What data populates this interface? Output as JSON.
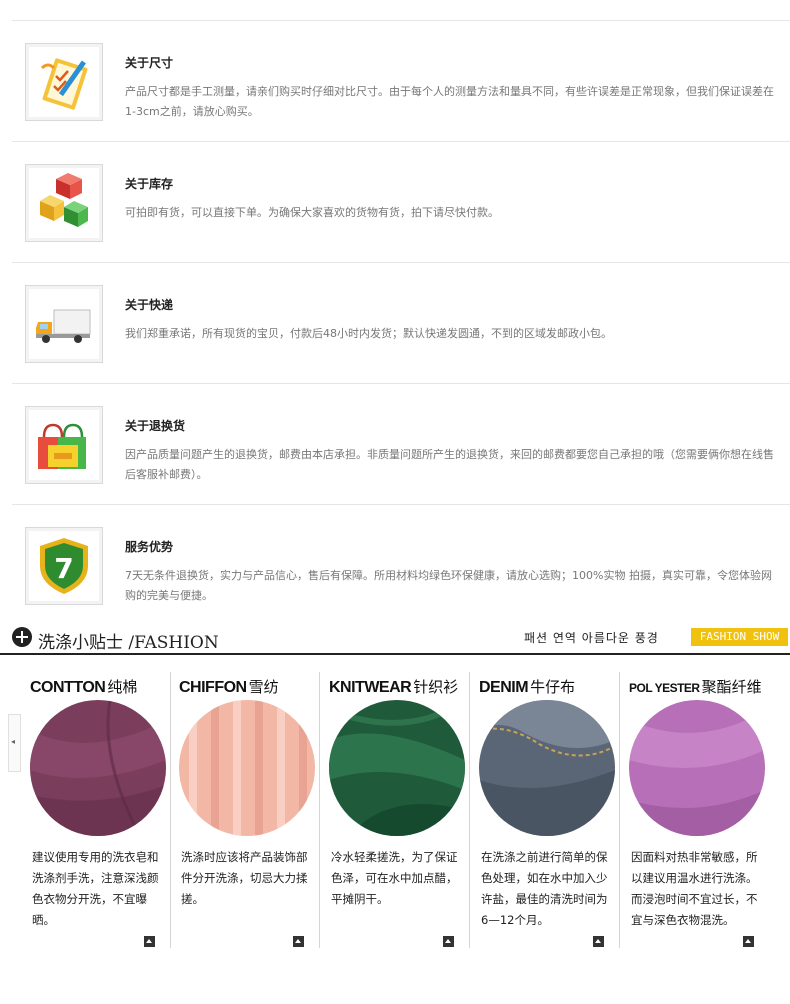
{
  "service": {
    "items": [
      {
        "title": "关于尺寸",
        "desc": "产品尺寸都是手工测量，请亲们购买时仔细对比尺寸。由于每个人的测量方法和量具不同，有些许误差是正常现象，但我们保证误差在 1-3cm之前，请放心购买。",
        "icon": "clipboard-icon"
      },
      {
        "title": "关于库存",
        "desc": "可拍即有货，可以直接下单。为确保大家喜欢的货物有货，拍下请尽快付款。",
        "icon": "boxes-icon"
      },
      {
        "title": "关于快递",
        "desc": "我们郑重承诺，所有现货的宝贝，付款后48小时内发货；默认快递发圆通，不到的区域发邮政小包。",
        "icon": "truck-icon"
      },
      {
        "title": "关于退换货",
        "desc": "因产品质量问题产生的退换货，邮费由本店承担。非质量问题所产生的退换货，来回的邮费都要您自己承担的哦（您需要俩你想在线售后客服补邮费）。",
        "icon": "shopping-bags-icon"
      },
      {
        "title": "服务优势",
        "desc": "7天无条件退换货，实力与产品信心，售后有保障。所用材料均绿色环保健康，请放心选购；100%实物 拍摄，真实可靠，令您体验网购的完美与便捷。",
        "icon": "shield-7-icon"
      }
    ]
  },
  "fashion": {
    "title": "洗涤小贴士 /FASHION",
    "korean": "패션 연역 아름다운 풍경",
    "badge": "FASHION SHOW",
    "fabrics": [
      {
        "en": "CONTTON",
        "cn": "纯棉",
        "care": "建议使用专用的洗衣皂和洗涤剂手洗，注意深浅颜色衣物分开洗，不宜曝晒。",
        "color": "#7a3d5c"
      },
      {
        "en": "CHIFFON",
        "cn": "雪纺",
        "care": "洗涤时应该将产品装饰部件分开洗涤，切忌大力揉搓。",
        "color": "#f3b7a6"
      },
      {
        "en": "KNITWEAR",
        "cn": "针织衫",
        "care": "冷水轻柔搓洗，为了保证色泽，可在水中加点醋，平摊阴干。",
        "color": "#1f5a3a"
      },
      {
        "en": "DENIM",
        "cn": "牛仔布",
        "care": "在洗涤之前进行简单的保色处理，如在水中加入少许盐，最佳的清洗时间为6—12个月。",
        "color": "#5a6676"
      },
      {
        "en": "POL YESTER",
        "cn": "聚酯纤维",
        "care": "因面料对热非常敏感，所以建议用温水进行洗涤。而浸泡时间不宜过长，不宜与深色衣物混洗。",
        "color": "#b76fb7"
      }
    ]
  }
}
